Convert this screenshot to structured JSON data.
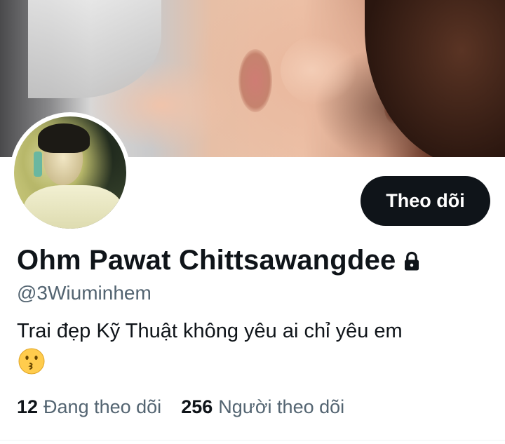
{
  "profile": {
    "display_name": "Ohm Pawat Chittsawangdee",
    "handle": "@3Wiuminhem",
    "bio_text": "Trai đẹp Kỹ Thuật không yêu ai chỉ yêu em",
    "bio_emoji": "kissing-face-emoji",
    "protected_icon": "lock-icon"
  },
  "actions": {
    "follow_label": "Theo dõi"
  },
  "stats": {
    "following_count": "12",
    "following_label": "Đang theo dõi",
    "followers_count": "256",
    "followers_label": "Người theo dõi"
  },
  "colors": {
    "text_primary": "#0f1419",
    "text_secondary": "#536471",
    "button_bg": "#0f1419",
    "button_text": "#ffffff"
  }
}
